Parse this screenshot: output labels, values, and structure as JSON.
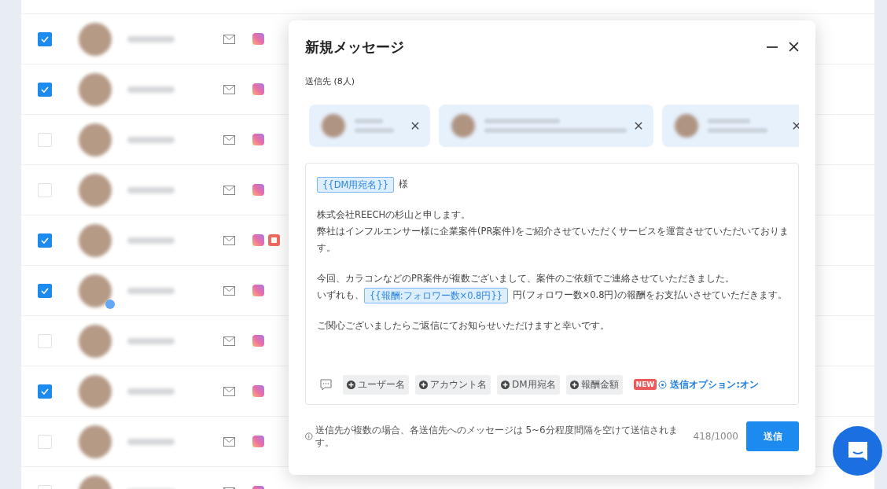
{
  "list": {
    "rows": [
      {
        "checked": true,
        "youtube": false,
        "badge": false
      },
      {
        "checked": true,
        "youtube": false,
        "badge": false
      },
      {
        "checked": false,
        "youtube": false,
        "badge": false
      },
      {
        "checked": false,
        "youtube": false,
        "badge": false
      },
      {
        "checked": true,
        "youtube": true,
        "badge": false
      },
      {
        "checked": true,
        "youtube": false,
        "badge": true
      },
      {
        "checked": false,
        "youtube": false,
        "badge": false
      },
      {
        "checked": true,
        "youtube": false,
        "badge": false
      },
      {
        "checked": false,
        "youtube": false,
        "badge": false
      },
      {
        "checked": false,
        "youtube": false,
        "badge": false
      }
    ]
  },
  "dialog": {
    "title": "新規メッセージ",
    "recipients_label": "送信先 (8人)",
    "body": [
      [
        [
          {
            "kind": "token",
            "text": "{{DM用宛名}}"
          },
          {
            "kind": "text",
            "text": "様"
          }
        ]
      ],
      [
        [
          {
            "kind": "text",
            "text": "株式会社REECHの杉山と申します。"
          }
        ],
        [
          {
            "kind": "text",
            "text": "弊社はインフルエンサー様に企業案件(PR案件)をご紹介させていただくサービスを運営させていただいておりま"
          }
        ],
        [
          {
            "kind": "text",
            "text": "す。"
          }
        ]
      ],
      [
        [
          {
            "kind": "text",
            "text": "今回、カラコンなどのPR案件が複数ございまして、案件のご依頼でご連絡させていただきました。"
          }
        ],
        [
          {
            "kind": "text",
            "text": "いずれも、"
          },
          {
            "kind": "token",
            "text": "{{報酬:フォロワー数×0.8円}}"
          },
          {
            "kind": "text",
            "text": "円(フォロワー数×0.8円)の報酬をお支払いさせていただきます。"
          }
        ]
      ],
      [
        [
          {
            "kind": "text",
            "text": "ご関心ございましたらご返信にてお知らせいただけますと幸いです。"
          }
        ]
      ]
    ],
    "insert_chips": [
      "ユーザー名",
      "アカウント名",
      "DM用宛名",
      "報酬金額"
    ],
    "new_badge": "NEW",
    "option_link": "送信オプション:オン",
    "note": "送信先が複数の場合、各送信先へのメッセージは 5~6分程度間隔を空けて送信されます。",
    "counter": "418/1000",
    "send": "送信"
  }
}
